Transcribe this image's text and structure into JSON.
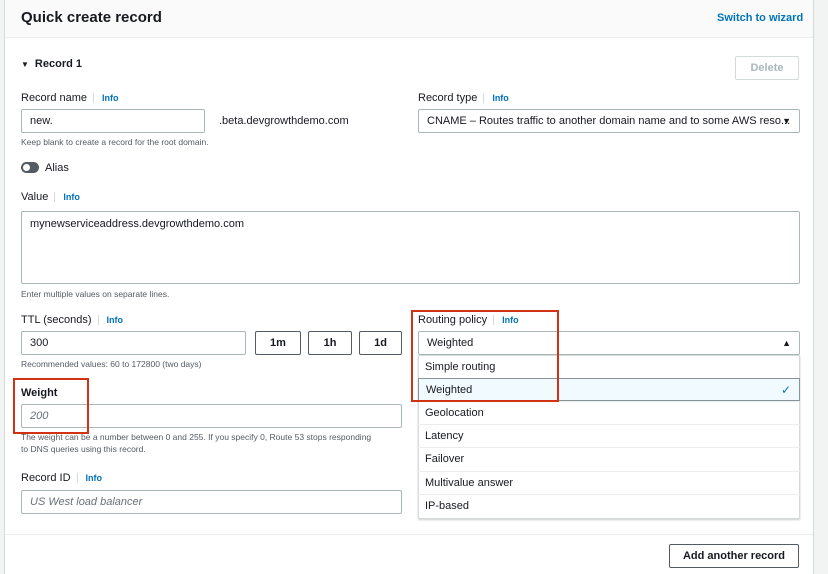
{
  "header": {
    "title": "Quick create record",
    "switch_link": "Switch to wizard"
  },
  "record": {
    "section_title": "Record 1",
    "delete_label": "Delete",
    "record_name": {
      "label": "Record name",
      "info": "Info",
      "value": "new.",
      "suffix": ".beta.devgrowthdemo.com",
      "hint": "Keep blank to create a record for the root domain."
    },
    "record_type": {
      "label": "Record type",
      "info": "Info",
      "value": "CNAME – Routes traffic to another domain name and to some AWS reso..."
    },
    "alias": {
      "label": "Alias",
      "enabled": false
    },
    "value": {
      "label": "Value",
      "info": "Info",
      "text": "mynewserviceaddress.devgrowthdemo.com",
      "hint": "Enter multiple values on separate lines."
    },
    "ttl": {
      "label": "TTL (seconds)",
      "info": "Info",
      "value": "300",
      "presets": [
        "1m",
        "1h",
        "1d"
      ],
      "hint": "Recommended values: 60 to 172800 (two days)"
    },
    "weight": {
      "label": "Weight",
      "placeholder": "200",
      "hint_line1": "The weight can be a number between 0 and 255. If you specify 0, Route 53 stops responding",
      "hint_line2": "to DNS queries using this record."
    },
    "record_id": {
      "label": "Record ID",
      "info": "Info",
      "placeholder": "US West load balancer"
    },
    "routing_policy": {
      "label": "Routing policy",
      "info": "Info",
      "value": "Weighted",
      "options": [
        "Simple routing",
        "Weighted",
        "Geolocation",
        "Latency",
        "Failover",
        "Multivalue answer",
        "IP-based"
      ],
      "selected_index": 1
    }
  },
  "footer": {
    "add_label": "Add another record"
  },
  "colors": {
    "accent": "#0073bb",
    "highlight": "#d13212",
    "selected_bg": "#f1faff"
  }
}
